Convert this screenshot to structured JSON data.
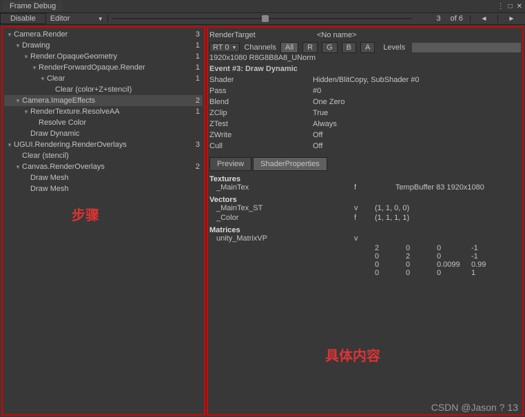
{
  "window": {
    "title": "Frame Debug"
  },
  "toolbar": {
    "disable": "Disable",
    "mode": "Editor",
    "current": "3",
    "total": "of 6",
    "prev": "◄",
    "next": "►"
  },
  "tree": [
    {
      "indent": 0,
      "caret": "▼",
      "label": "Camera.Render",
      "count": "3",
      "sel": false
    },
    {
      "indent": 1,
      "caret": "▼",
      "label": "Drawing",
      "count": "1",
      "sel": false
    },
    {
      "indent": 2,
      "caret": "▼",
      "label": "Render.OpaqueGeometry",
      "count": "1",
      "sel": false
    },
    {
      "indent": 3,
      "caret": "▼",
      "label": "RenderForwardOpaque.Render",
      "count": "1",
      "sel": false
    },
    {
      "indent": 4,
      "caret": "▼",
      "label": "Clear",
      "count": "1",
      "sel": false
    },
    {
      "indent": 5,
      "caret": "",
      "label": "Clear (color+Z+stencil)",
      "count": "",
      "sel": false
    },
    {
      "indent": 1,
      "caret": "▼",
      "label": "Camera.ImageEffects",
      "count": "2",
      "sel": true
    },
    {
      "indent": 2,
      "caret": "▼",
      "label": "RenderTexture.ResolveAA",
      "count": "1",
      "sel": false
    },
    {
      "indent": 3,
      "caret": "",
      "label": "Resolve Color",
      "count": "",
      "sel": false
    },
    {
      "indent": 2,
      "caret": "",
      "label": "Draw Dynamic",
      "count": "",
      "sel": false
    },
    {
      "indent": 0,
      "caret": "▼",
      "label": "UGUI.Rendering.RenderOverlays",
      "count": "3",
      "sel": false
    },
    {
      "indent": 1,
      "caret": "",
      "label": "Clear (stencil)",
      "count": "",
      "sel": false
    },
    {
      "indent": 1,
      "caret": "▼",
      "label": "Canvas.RenderOverlays",
      "count": "2",
      "sel": false
    },
    {
      "indent": 2,
      "caret": "",
      "label": "Draw Mesh",
      "count": "",
      "sel": false
    },
    {
      "indent": 2,
      "caret": "",
      "label": "Draw Mesh",
      "count": "",
      "sel": false
    }
  ],
  "rt": {
    "label": "RenderTarget",
    "name": "<No name>",
    "sel": "RT 0",
    "channels": "Channels",
    "all": "All",
    "r": "R",
    "g": "G",
    "b": "B",
    "a": "A",
    "levels": "Levels"
  },
  "info": {
    "res": "1920x1080 R8G8B8A8_UNorm",
    "event": "Event #3: Draw Dynamic",
    "rows": [
      {
        "k": "Shader",
        "v": "Hidden/BlitCopy, SubShader #0"
      },
      {
        "k": "Pass",
        "v": "#0"
      },
      {
        "k": "Blend",
        "v": "One Zero"
      },
      {
        "k": "ZClip",
        "v": "True"
      },
      {
        "k": "ZTest",
        "v": "Always"
      },
      {
        "k": "ZWrite",
        "v": "Off"
      },
      {
        "k": "Cull",
        "v": "Off"
      }
    ]
  },
  "tabs": {
    "preview": "Preview",
    "shader": "ShaderProperties"
  },
  "props": {
    "tex_h": "Textures",
    "tex": {
      "name": "_MainTex",
      "type": "f",
      "val": "TempBuffer 83 1920x1080"
    },
    "vec_h": "Vectors",
    "vecs": [
      {
        "name": "_MainTex_ST",
        "type": "v",
        "val": "(1, 1, 0, 0)"
      },
      {
        "name": "_Color",
        "type": "f",
        "val": "(1, 1, 1, 1)"
      }
    ],
    "mat_h": "Matrices",
    "mat": {
      "name": "unity_MatrixVP",
      "type": "v",
      "rows": [
        [
          "2",
          "0",
          "0",
          "-1"
        ],
        [
          "0",
          "2",
          "0",
          "-1"
        ],
        [
          "0",
          "0",
          "0.0099",
          "0.99"
        ],
        [
          "0",
          "0",
          "0",
          "1"
        ]
      ]
    }
  },
  "annotations": {
    "left": "步骤",
    "right": "具体内容"
  },
  "watermark": "CSDN @Jason ? 13"
}
